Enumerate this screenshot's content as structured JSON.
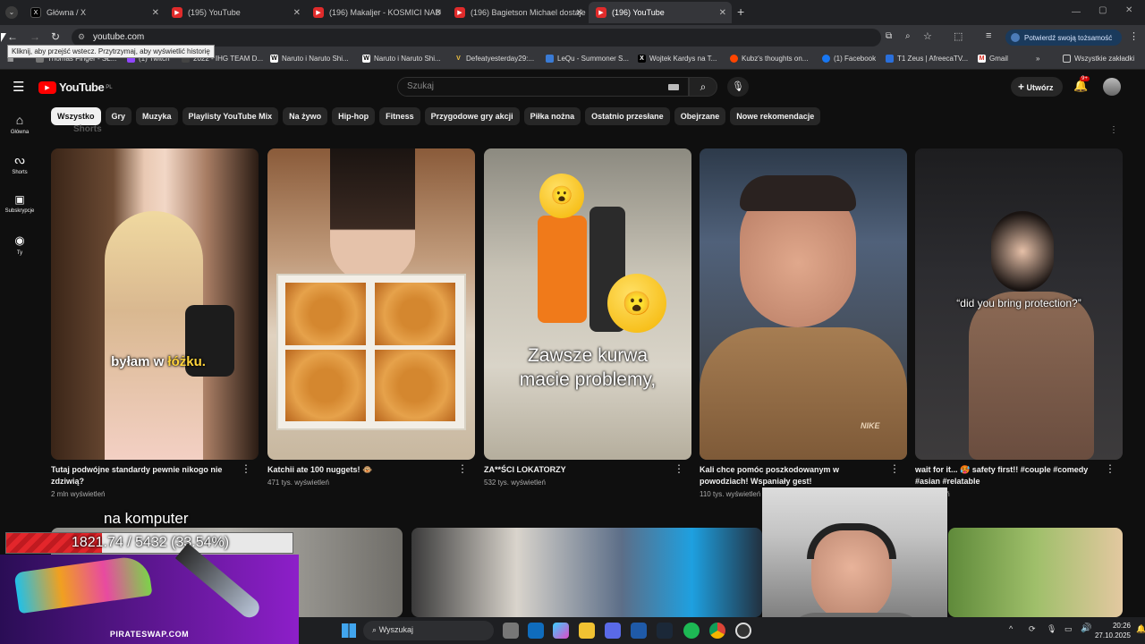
{
  "browser": {
    "tabs": [
      {
        "title": "Główna / X",
        "icon": "x-logo-icon"
      },
      {
        "title": "(195) YouTube",
        "icon": "youtube-icon"
      },
      {
        "title": "(196) Makaljer - KOSMICI NAD",
        "icon": "youtube-icon"
      },
      {
        "title": "(196) Bagietson Michael dostaje",
        "icon": "youtube-icon"
      },
      {
        "title": "(196) YouTube",
        "icon": "youtube-icon"
      }
    ],
    "new_tab": "+",
    "url": "youtube.com",
    "tooltip": "Kliknij, aby przejść wstecz. Przytrzymaj, aby wyświetlić historię",
    "profile_button": "Potwierdź swoją tożsamość",
    "bookmarks": [
      "Thomas Finger - SŁ...",
      "(1) Twitch",
      "2022 - IHG TEAM D...",
      "Naruto i Naruto Shi...",
      "Naruto i Naruto Shi...",
      "Defeatyesterday29:...",
      "LeQu - Summoner S...",
      "Wojtek Kardys na T...",
      "Kubz's thoughts on...",
      "(1) Facebook",
      "T1 Zeus | AfreecaTV...",
      "Gmail"
    ],
    "all_bookmarks": "Wszystkie zakładki",
    "more_bookmarks": "»"
  },
  "youtube": {
    "logo": "YouTube",
    "logo_region": "PL",
    "search_placeholder": "Szukaj",
    "create_label": "Utwórz",
    "notif_badge": "9+",
    "sidebar": [
      {
        "label": "Główna",
        "icon": "home-icon"
      },
      {
        "label": "Shorts",
        "icon": "shorts-icon"
      },
      {
        "label": "Subskrypcje",
        "icon": "subscriptions-icon"
      },
      {
        "label": "Ty",
        "icon": "you-icon"
      }
    ],
    "chips": [
      "Wszystko",
      "Gry",
      "Muzyka",
      "Playlisty YouTube Mix",
      "Na żywo",
      "Hip-hop",
      "Fitness",
      "Przygodowe gry akcji",
      "Piłka nożna",
      "Ostatnio przesłane",
      "Obejrzane",
      "Nowe rekomendacje"
    ],
    "section_label": "Shorts",
    "shorts": [
      {
        "title": "Tutaj podwójne standardy pewnie nikogo nie zdziwią?",
        "views": "2 mln wyświetleń",
        "overlay_a": "byłam w ",
        "overlay_b": "łóżku."
      },
      {
        "title": "Katchii ate 100 nuggets! 🐵",
        "views": "471 tys. wyświetleń",
        "overlay_a": "",
        "overlay_b": ""
      },
      {
        "title": "ZA**ŚCI LOKATORZY",
        "views": "532 tys. wyświetleń",
        "overlay_a": "Zawsze kurwa",
        "overlay_b": "macie problemy,"
      },
      {
        "title": "Kali chce pomóc poszkodowanym w powodziach! Wspaniały gest!",
        "views": "110 tys. wyświetleń",
        "overlay_a": "",
        "overlay_b": ""
      },
      {
        "title": "wait for it... 🥵 safety first!! #couple #comedy #asian #relatable",
        "views": "wyświetleń",
        "overlay_a": "“did you bring protection?”",
        "overlay_b": ""
      }
    ],
    "shirt_brand": "NIKE"
  },
  "overlay": {
    "stream_text": "na komputer",
    "progress_text": "1821.74 / 5432 (33.54%)",
    "progress_fraction": 0.3354,
    "sponsor": "PIRATESWAP.COM"
  },
  "taskbar": {
    "search_placeholder": "Wyszukaj",
    "time": "20:26",
    "date": "27.10.2025"
  }
}
